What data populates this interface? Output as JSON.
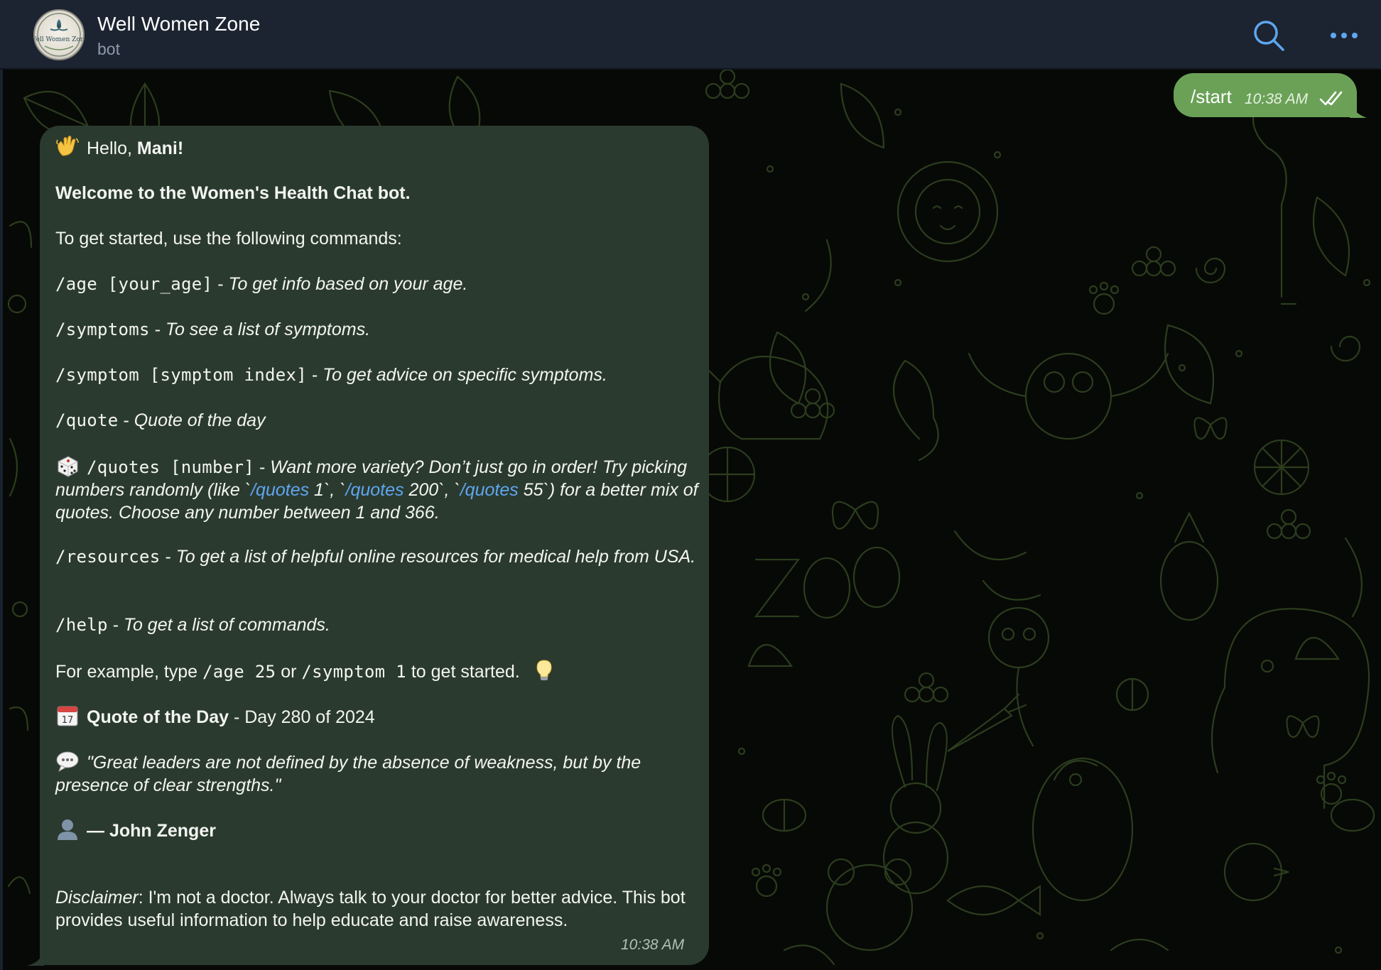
{
  "header": {
    "title": "Well Women Zone",
    "subtitle": "bot",
    "avatar_text": "Well Women Zone"
  },
  "outgoing": {
    "text": "/start",
    "time": "10:38 AM"
  },
  "incoming": {
    "greeting_prefix": "Hello, ",
    "greeting_name": "Mani!",
    "welcome": "Welcome to the Women's Health Chat bot.",
    "intro": "To get started, use the following commands:",
    "commands": [
      {
        "cmd": "/age [your_age]",
        "desc": "To get info based on your age."
      },
      {
        "cmd": "/symptoms",
        "desc": "To see a list of symptoms."
      },
      {
        "cmd": "/symptom [symptom index]",
        "desc": "To get advice on specific symptoms."
      },
      {
        "cmd": "/quote",
        "desc": "Quote of the day"
      }
    ],
    "quotes_cmd": "/quotes [number]",
    "quotes_desc_1": "Want more variety? Don’t just go in order! Try picking numbers randomly (like `",
    "quotes_link": "/quotes",
    "quotes_n1": " 1`, `",
    "quotes_n2": " 200`, `",
    "quotes_n3": " 55`) for a better mix of quotes. Choose any number between 1 and 366.",
    "resources_cmd": "/resources",
    "resources_desc": "To get a list of helpful online resources for medical help from USA.",
    "help_cmd": "/help",
    "help_desc": "To get a list of commands.",
    "example_1": "For example, type ",
    "example_cmd1": "/age 25",
    "example_or": " or ",
    "example_cmd2": "/symptom 1",
    "example_2": " to get started.",
    "quote_heading": "Quote of the Day",
    "quote_day": " - Day 280 of 2024",
    "quote_text": "\"Great leaders are not defined by the absence of weakness, but by the presence of clear strengths.\"",
    "quote_author": "— John Zenger",
    "disclaimer_label": "Disclaimer",
    "disclaimer_text": ": I'm not a doctor. Always talk to your doctor for better advice. This bot provides useful information to help educate and raise awareness.",
    "time": "10:38 AM",
    "calendar_day": "17"
  },
  "colors": {
    "header_bg": "#1c2431",
    "outgoing_bubble": "#6aa157",
    "incoming_bubble": "#2b3a2f",
    "link": "#5ea6f0",
    "icon_accent": "#5ea6f0",
    "pattern_stroke": "#2a3a1c"
  },
  "icons": {
    "search": "search-icon",
    "more": "more-icon",
    "read_receipt": "double-check-icon"
  }
}
